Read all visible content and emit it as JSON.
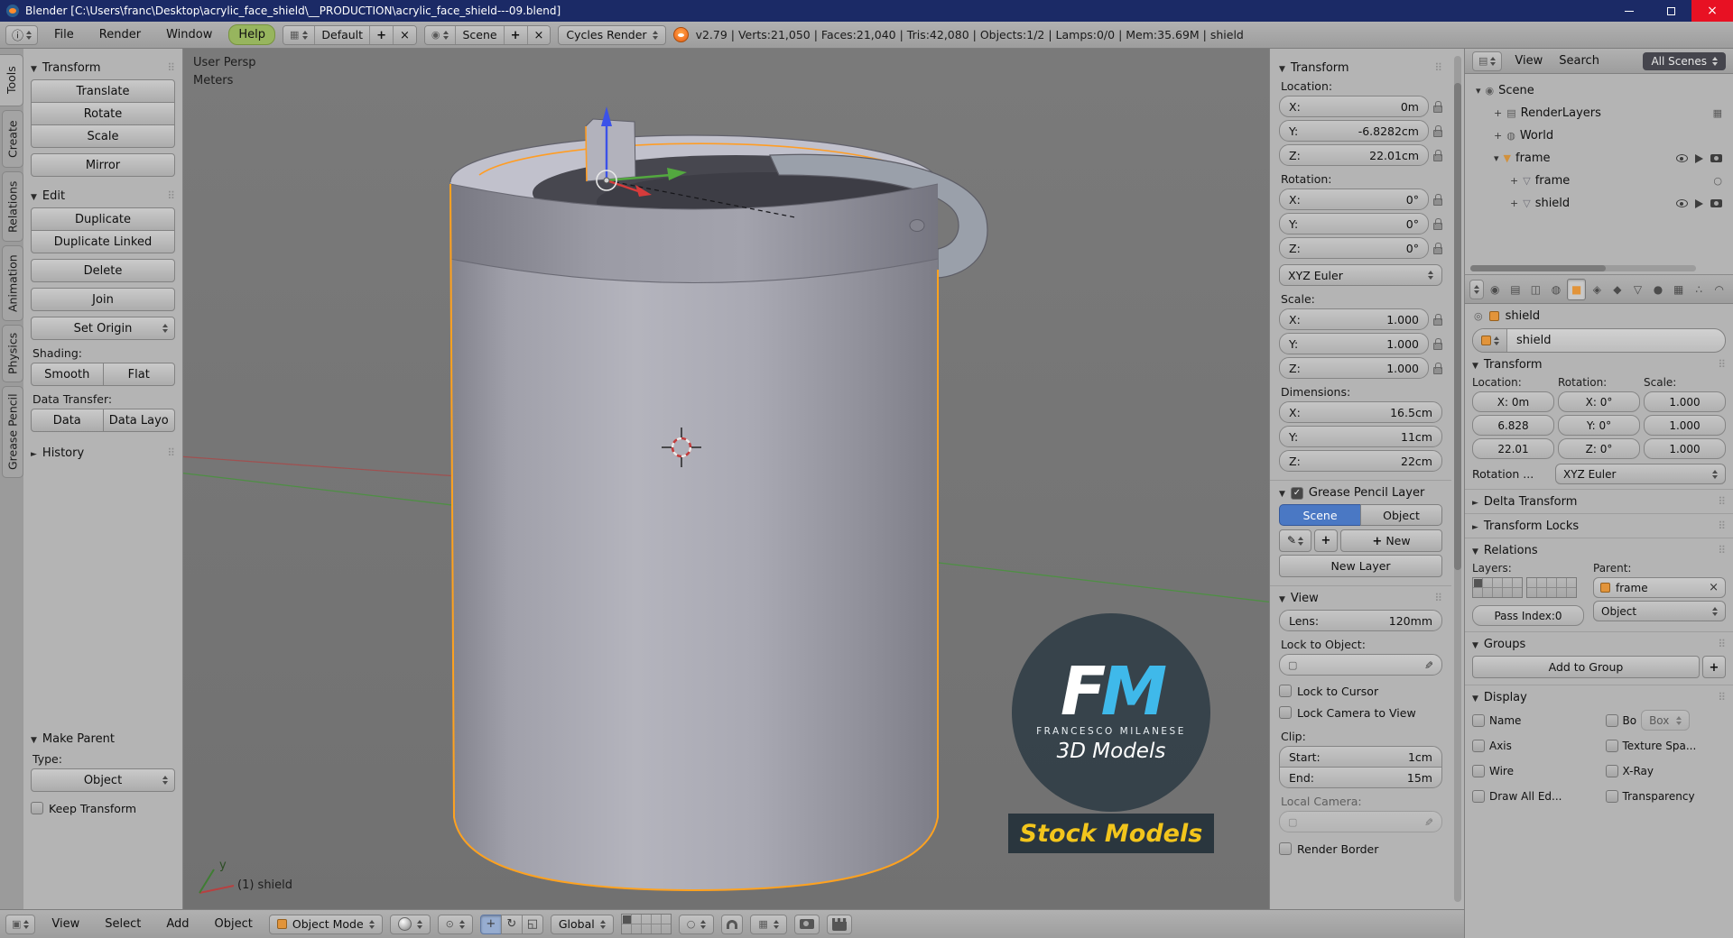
{
  "titlebar": {
    "title": "Blender [C:\\Users\\franc\\Desktop\\acrylic_face_shield\\__PRODUCTION\\acrylic_face_shield---09.blend]"
  },
  "topbar": {
    "menus": {
      "file": "File",
      "render": "Render",
      "window": "Window",
      "help": "Help"
    },
    "layout": "Default",
    "scene": "Scene",
    "engine": "Cycles Render",
    "stats": "v2.79 | Verts:21,050 | Faces:21,040 | Tris:42,080 | Objects:1/2 | Lamps:0/0 | Mem:35.69M | shield"
  },
  "tabs": [
    "Tools",
    "Create",
    "Relations",
    "Animation",
    "Physics",
    "Grease Pencil"
  ],
  "toolshelf": {
    "transform": {
      "title": "Transform",
      "translate": "Translate",
      "rotate": "Rotate",
      "scale": "Scale",
      "mirror": "Mirror"
    },
    "edit": {
      "title": "Edit",
      "duplicate": "Duplicate",
      "duplicate_linked": "Duplicate Linked",
      "del": "Delete",
      "join": "Join",
      "set_origin": "Set Origin"
    },
    "shading_label": "Shading:",
    "smooth": "Smooth",
    "flat": "Flat",
    "data_transfer_label": "Data Transfer:",
    "data": "Data",
    "data_layout": "Data Layo",
    "history": "History",
    "make_parent": {
      "title": "Make Parent",
      "type_label": "Type:",
      "type": "Object",
      "keep_transform": "Keep Transform"
    }
  },
  "viewport": {
    "view_label": "User Persp",
    "units_label": "Meters",
    "active_label": "(1) shield",
    "axis_y": "y",
    "watermark": {
      "f": "F",
      "m": "M",
      "name": "FRANCESCO MILANESE",
      "line2": "3D Models",
      "badge": "Stock Models"
    }
  },
  "npanel": {
    "transform": {
      "title": "Transform",
      "location_label": "Location:",
      "loc": [
        {
          "k": "X:",
          "v": "0m"
        },
        {
          "k": "Y:",
          "v": "-6.8282cm"
        },
        {
          "k": "Z:",
          "v": "22.01cm"
        }
      ],
      "rotation_label": "Rotation:",
      "rot": [
        {
          "k": "X:",
          "v": "0°"
        },
        {
          "k": "Y:",
          "v": "0°"
        },
        {
          "k": "Z:",
          "v": "0°"
        }
      ],
      "euler": "XYZ Euler",
      "scale_label": "Scale:",
      "scl": [
        {
          "k": "X:",
          "v": "1.000"
        },
        {
          "k": "Y:",
          "v": "1.000"
        },
        {
          "k": "Z:",
          "v": "1.000"
        }
      ],
      "dimensions_label": "Dimensions:",
      "dim": [
        {
          "k": "X:",
          "v": "16.5cm"
        },
        {
          "k": "Y:",
          "v": "11cm"
        },
        {
          "k": "Z:",
          "v": "22cm"
        }
      ]
    },
    "grease": {
      "title": "Grease Pencil Layer",
      "scene": "Scene",
      "object": "Object",
      "new": "New",
      "new_layer": "New Layer"
    },
    "view": {
      "title": "View",
      "lens_k": "Lens:",
      "lens_v": "120mm",
      "lock_to_object": "Lock to Object:",
      "lock_to_cursor": "Lock to Cursor",
      "lock_camera": "Lock Camera to View",
      "clip_label": "Clip:",
      "start_k": "Start:",
      "start_v": "1cm",
      "end_k": "End:",
      "end_v": "15m",
      "local_camera": "Local Camera:",
      "render_border": "Render Border"
    }
  },
  "outliner": {
    "view": "View",
    "search": "Search",
    "display_mode": "All Scenes",
    "rows": [
      "Scene",
      "RenderLayers",
      "World",
      "frame",
      "frame",
      "shield"
    ]
  },
  "properties": {
    "breadcrumb": "shield",
    "name": "shield",
    "transform": {
      "title": "Transform",
      "location_label": "Location:",
      "rotation_label": "Rotation:",
      "scale_label": "Scale:",
      "loc": [
        "X: 0m",
        "6.828",
        "22.01"
      ],
      "rot": [
        "X: 0°",
        "Y: 0°",
        "Z: 0°"
      ],
      "scl": [
        "1.000",
        "1.000",
        "1.000"
      ],
      "rotmode_label": "Rotation ...",
      "rotmode": "XYZ Euler"
    },
    "delta": "Delta Transform",
    "locks": "Transform Locks",
    "relations": {
      "title": "Relations",
      "layers_label": "Layers:",
      "parent_label": "Parent:",
      "parent": "frame",
      "parent_type": "Object",
      "pass_index": "Pass Index:0"
    },
    "groups": {
      "title": "Groups",
      "add": "Add to Group"
    },
    "display": {
      "title": "Display",
      "name": "Name",
      "axis": "Axis",
      "wire": "Wire",
      "draw_all": "Draw All Ed...",
      "bounds": "Bo",
      "bounds_type": "Box",
      "texspace": "Texture Spa...",
      "xray": "X-Ray",
      "transparency": "Transparency"
    }
  },
  "bottombar": {
    "view": "View",
    "select": "Select",
    "add": "Add",
    "object": "Object",
    "mode": "Object Mode",
    "orientation": "Global"
  }
}
